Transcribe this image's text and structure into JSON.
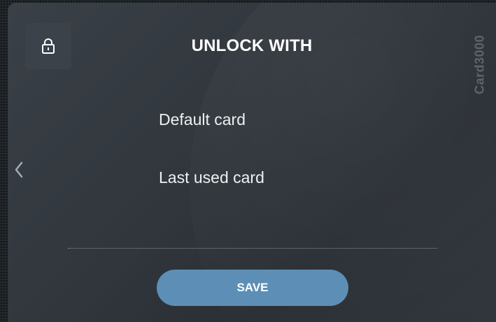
{
  "dialog": {
    "title": "UNLOCK WITH",
    "brand": "Card3000",
    "lock_icon": "lock-icon",
    "back_icon": "chevron-left-icon"
  },
  "options": [
    {
      "label": "Default card"
    },
    {
      "label": "Last used card"
    }
  ],
  "actions": {
    "save_label": "SAVE"
  },
  "colors": {
    "accent": "#5d8fb6",
    "background": "#30363c",
    "text": "#ffffff"
  }
}
